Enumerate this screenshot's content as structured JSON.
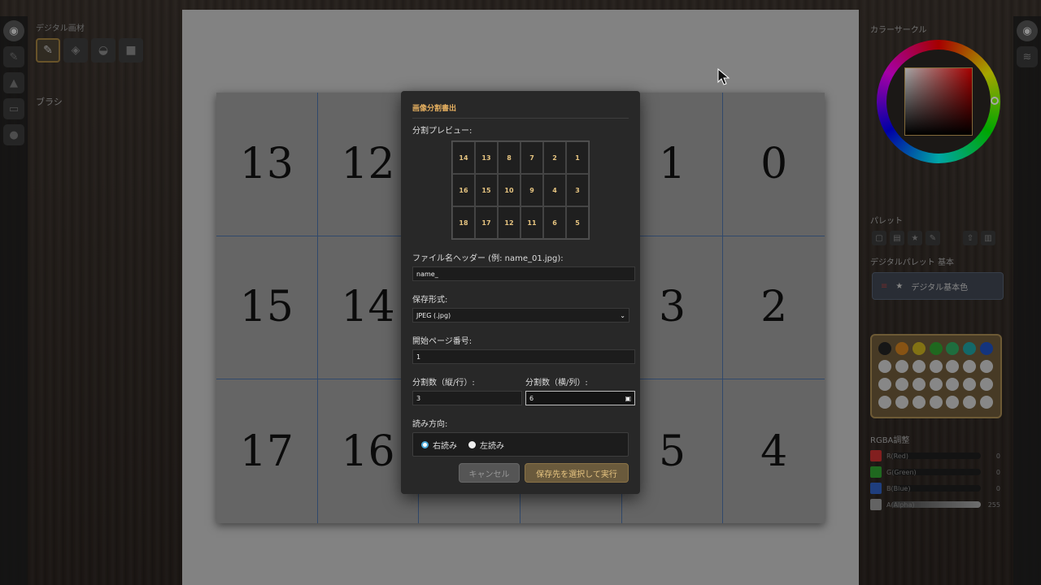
{
  "left_panel": {
    "section_title": "デジタル画材",
    "brush_label": "ブラシ",
    "tools": [
      "brush-icon",
      "eraser-icon",
      "bucket-icon",
      "gradient-icon"
    ]
  },
  "canvas": {
    "cells": [
      "13",
      "12",
      "",
      "",
      "1",
      "0",
      "15",
      "14",
      "",
      "",
      "3",
      "2",
      "17",
      "16",
      "",
      "",
      "5",
      "4"
    ]
  },
  "dialog": {
    "title": "画像分割書出",
    "preview_label": "分割プレビュー:",
    "preview_cells": [
      "14",
      "13",
      "8",
      "7",
      "2",
      "1",
      "16",
      "15",
      "10",
      "9",
      "4",
      "3",
      "18",
      "17",
      "12",
      "11",
      "6",
      "5"
    ],
    "filename_label": "ファイル名ヘッダー (例: name_01.jpg):",
    "filename_value": "name_",
    "format_label": "保存形式:",
    "format_value": "JPEG (.jpg)",
    "start_page_label": "開始ページ番号:",
    "start_page_value": "1",
    "rows_label": "分割数（縦/行）:",
    "rows_value": "3",
    "cols_label": "分割数（横/列）:",
    "cols_value": "6",
    "direction_label": "読み方向:",
    "radio_right": "右読み",
    "radio_left": "左読み",
    "cancel_label": "キャンセル",
    "exec_label": "保存先を選択して実行"
  },
  "right_panel": {
    "color_circle_title": "カラーサークル",
    "palette_title": "パレット",
    "palette_name": "デジタルパレット 基本",
    "palette_button": "デジタル基本色",
    "rgba_title": "RGBA調整",
    "rgba": [
      {
        "label": "R(Red)",
        "value": "0",
        "color": "#c83030"
      },
      {
        "label": "G(Green)",
        "value": "0",
        "color": "#30a030"
      },
      {
        "label": "B(Blue)",
        "value": "0",
        "color": "#3060c0"
      },
      {
        "label": "A(Alpha)",
        "value": "255",
        "color": "#999999"
      }
    ]
  }
}
